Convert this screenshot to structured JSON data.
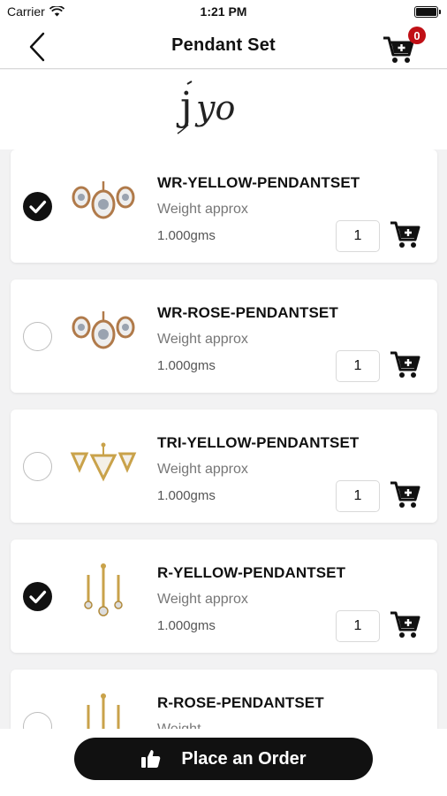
{
  "status_bar": {
    "carrier": "Carrier",
    "time": "1:21 PM"
  },
  "nav": {
    "title": "Pendant Set",
    "cart_count": "0"
  },
  "brand": {
    "logo_text": "JIYO"
  },
  "products": [
    {
      "name": "WR-YELLOW-PENDANTSET",
      "weight_label": "Weight approx",
      "weight_value": "1.000gms",
      "quantity": "1",
      "selected": true,
      "thumb": "oval-set"
    },
    {
      "name": "WR-ROSE-PENDANTSET",
      "weight_label": "Weight approx",
      "weight_value": "1.000gms",
      "quantity": "1",
      "selected": false,
      "thumb": "oval-set"
    },
    {
      "name": "TRI-YELLOW-PENDANTSET",
      "weight_label": "Weight approx",
      "weight_value": "1.000gms",
      "quantity": "1",
      "selected": false,
      "thumb": "triangle-set"
    },
    {
      "name": "R-YELLOW-PENDANTSET",
      "weight_label": "Weight approx",
      "weight_value": "1.000gms",
      "quantity": "1",
      "selected": true,
      "thumb": "drop-set"
    },
    {
      "name": "R-ROSE-PENDANTSET",
      "weight_label": "Weight",
      "weight_value": "",
      "quantity": "",
      "selected": false,
      "thumb": "drop-set"
    }
  ],
  "footer": {
    "order_label": "Place an Order"
  },
  "colors": {
    "accent": "#111111",
    "badge": "#c01016",
    "background": "#f2f2f3"
  }
}
